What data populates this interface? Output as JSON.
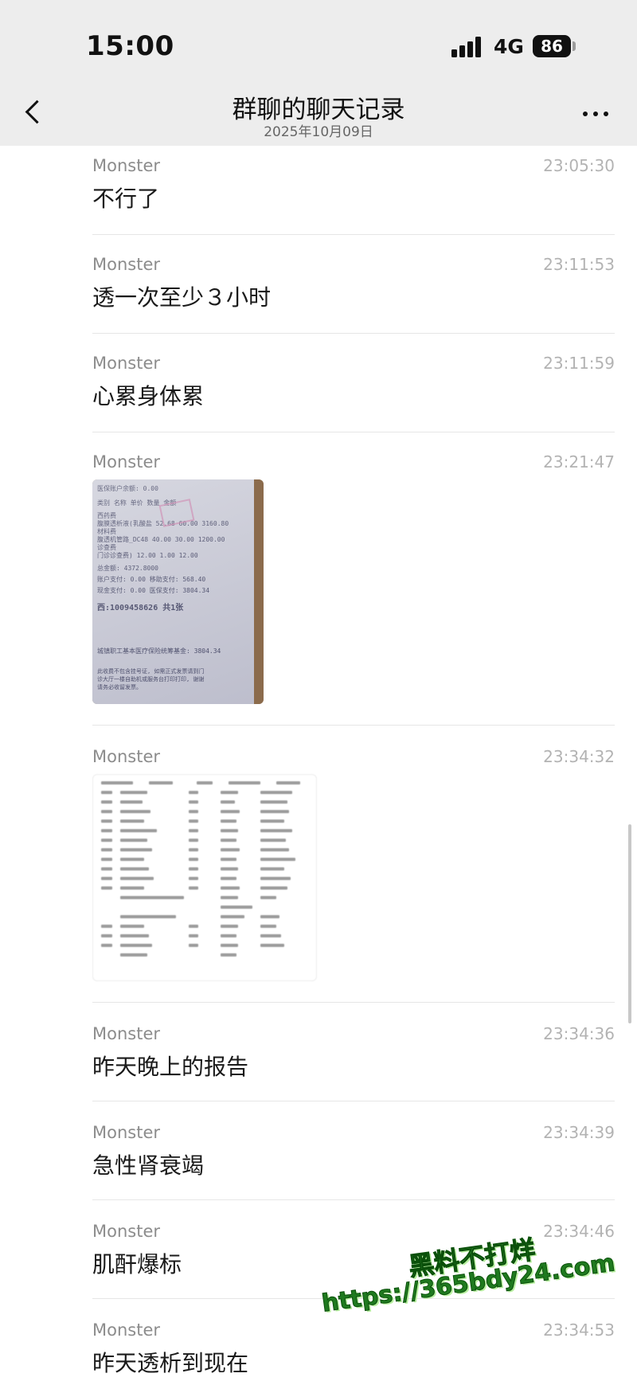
{
  "status_bar": {
    "time": "15:00",
    "network": "4G",
    "battery": "86"
  },
  "header": {
    "title": "群聊的聊天记录",
    "date": "2025年10月09日"
  },
  "messages": [
    {
      "sender": "Monster",
      "time": "23:05:30",
      "text": "不行了"
    },
    {
      "sender": "Monster",
      "time": "23:11:53",
      "text": "透一次至少３小时"
    },
    {
      "sender": "Monster",
      "time": "23:11:59",
      "text": "心累身体累"
    },
    {
      "sender": "Monster",
      "time": "23:21:47",
      "text": ""
    },
    {
      "sender": "Monster",
      "time": "23:34:32",
      "text": ""
    },
    {
      "sender": "Monster",
      "time": "23:34:36",
      "text": "昨天晚上的报告"
    },
    {
      "sender": "Monster",
      "time": "23:34:39",
      "text": "急性肾衰竭"
    },
    {
      "sender": "Monster",
      "time": "23:34:46",
      "text": "肌酐爆标"
    },
    {
      "sender": "Monster",
      "time": "23:34:53",
      "text": "昨天透析到现在"
    }
  ],
  "receipt_image": {
    "lines": [
      "医保账户余额: 0.00",
      "类别    名称       单价   数量   金额",
      "西药费",
      "腹膜透析液(乳酸盐   52.68 60.00 3160.80",
      "材料费",
      "腹透机管路_DC48   40.00 30.00 1200.00",
      "诊查费",
      "门诊诊查费)      12.00  1.00  12.00",
      "总金额: 4372.8000",
      "账户支付: 0.00      移助支付: 568.40",
      "现金支付: 0.00      医保支付: 3804.34",
      "西:1009458626  共1张",
      "城镇职工基本医疗保险统筹基金: 3804.34",
      "此收费不包含挂号证, 如需正式发票请到门",
      "诊大厅一楼自助机或服务台打印打印, 谢谢",
      "请务必收留发票。"
    ]
  },
  "watermark": {
    "line1": "黑料不打烊",
    "line2": "https://365bdy24.com"
  }
}
